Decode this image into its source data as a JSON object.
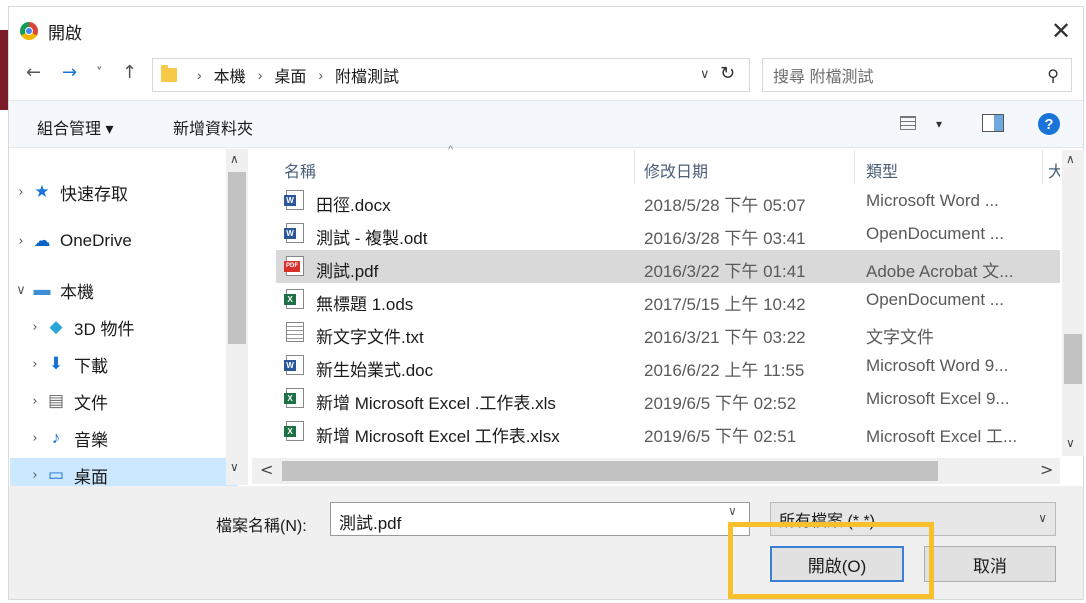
{
  "window": {
    "title": "開啟",
    "close_glyph": "✕"
  },
  "nav": {
    "back": "←",
    "forward": "→",
    "recent": "˅",
    "up": "↑",
    "breadcrumb": [
      "本機",
      "桌面",
      "附檔測試"
    ],
    "breadcrumb_sep": "›",
    "address_dropdown": "∨",
    "refresh": "↻",
    "search_placeholder": "搜尋 附檔測試",
    "search_icon": "⚲"
  },
  "toolbar": {
    "organize": "組合管理 ▾",
    "new_folder": "新增資料夾",
    "view_dropdown": "▾",
    "help": "?"
  },
  "tree": {
    "up": "∧",
    "down": "∨",
    "items": [
      {
        "chevron": "›",
        "icon": "star-icon",
        "glyph": "★",
        "color": "#1a73d9",
        "label": "快速存取"
      },
      {
        "chevron": "›",
        "icon": "onedrive-icon",
        "glyph": "☁",
        "color": "#0a64c8",
        "label": "OneDrive"
      },
      {
        "chevron": "∨",
        "icon": "computer-icon",
        "glyph": "▬",
        "color": "#3d8fd6",
        "label": "本機"
      },
      {
        "chevron": "›",
        "icon": "3d-objects-icon",
        "glyph": "◆",
        "color": "#26a5d8",
        "label": "3D 物件"
      },
      {
        "chevron": "›",
        "icon": "download-icon",
        "glyph": "⬇",
        "color": "#1a6fd1",
        "label": "下載"
      },
      {
        "chevron": "›",
        "icon": "documents-icon",
        "glyph": "▤",
        "color": "#666666",
        "label": "文件"
      },
      {
        "chevron": "›",
        "icon": "music-icon",
        "glyph": "♪",
        "color": "#1a6fd1",
        "label": "音樂"
      },
      {
        "chevron": "›",
        "icon": "desktop-icon",
        "glyph": "▭",
        "color": "#1a6fd1",
        "label": "桌面"
      }
    ]
  },
  "list": {
    "columns": [
      "名稱",
      "修改日期",
      "類型",
      "大"
    ],
    "sort_caret": "^",
    "scroll_up": "∧",
    "scroll_down": "∨",
    "scroll_left": "<",
    "scroll_right": ">",
    "files": [
      {
        "icon": "word-doc-icon",
        "tag": "W",
        "tagcolor": "#2b579a",
        "name": "田徑.docx",
        "date": "2018/5/28 下午 05:07",
        "type": "Microsoft Word ..."
      },
      {
        "icon": "odt-doc-icon",
        "tag": "W",
        "tagcolor": "#2b579a",
        "name": "測試 - 複製.odt",
        "date": "2016/3/28 下午 03:41",
        "type": "OpenDocument ..."
      },
      {
        "icon": "pdf-icon",
        "tag": "PDF",
        "tagcolor": "#d9302c",
        "name": "測試.pdf",
        "date": "2016/3/22 下午 01:41",
        "type": "Adobe Acrobat 文..."
      },
      {
        "icon": "ods-sheet-icon",
        "tag": "X",
        "tagcolor": "#1e7145",
        "name": "無標題 1.ods",
        "date": "2017/5/15 上午 10:42",
        "type": "OpenDocument ..."
      },
      {
        "icon": "text-file-icon",
        "tag": "",
        "tagcolor": "#ffffff",
        "name": "新文字文件.txt",
        "date": "2016/3/21 下午 03:22",
        "type": "文字文件"
      },
      {
        "icon": "word-doc-icon",
        "tag": "W",
        "tagcolor": "#2b579a",
        "name": "新生始業式.doc",
        "date": "2016/6/22 上午 11:55",
        "type": "Microsoft Word 9..."
      },
      {
        "icon": "excel-xls-icon",
        "tag": "X",
        "tagcolor": "#1e7145",
        "name": "新增 Microsoft Excel .工作表.xls",
        "date": "2019/6/5 下午 02:52",
        "type": "Microsoft Excel 9..."
      },
      {
        "icon": "excel-xlsx-icon",
        "tag": "X",
        "tagcolor": "#1e7145",
        "name": "新增 Microsoft Excel 工作表.xlsx",
        "date": "2019/6/5 下午 02:51",
        "type": "Microsoft Excel 工..."
      }
    ],
    "selected_index": 2
  },
  "bottom": {
    "filename_label": "檔案名稱(N):",
    "filename_value": "測試.pdf",
    "filename_dropdown": "∨",
    "filetype_value": "所有檔案 (*.*)",
    "filetype_dropdown": "∨",
    "open_button": "開啟(O)",
    "cancel_button": "取消"
  },
  "colors": {
    "highlight": "#f9c02c",
    "selection": "#d9d9d9",
    "tree_selection": "#cce8ff",
    "accent": "#1a73d9"
  }
}
